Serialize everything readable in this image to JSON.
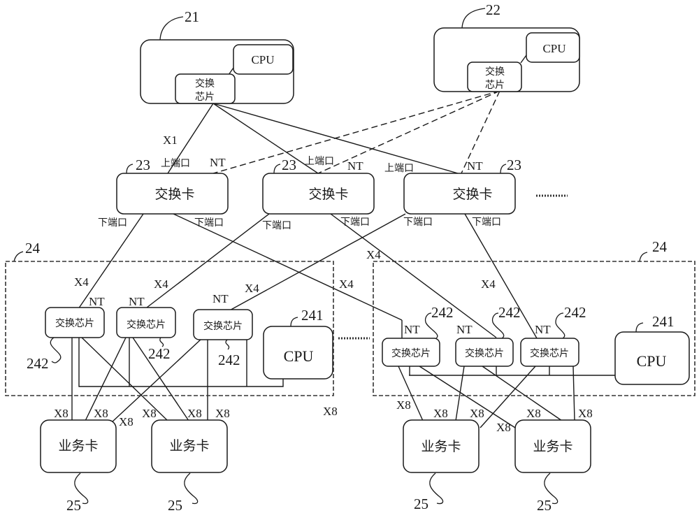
{
  "diagram": {
    "top_devices": [
      {
        "ref": "21",
        "cpu": "CPU",
        "chip_line1": "交换",
        "chip_line2": "芯片"
      },
      {
        "ref": "22",
        "cpu": "CPU",
        "chip_line1": "交换",
        "chip_line2": "芯片"
      }
    ],
    "link_x1": "X1",
    "switch_cards": [
      {
        "ref": "23",
        "label": "交换卡",
        "up_port": "上端口",
        "nt": "NT",
        "down_left": "下端口",
        "down_right": "下端口"
      },
      {
        "ref": "23",
        "label": "交换卡",
        "up_port": "上端口",
        "nt": "NT",
        "down_left": "下端口",
        "down_right": "下端口"
      },
      {
        "ref": "23",
        "label": "交换卡",
        "up_port": "上端口",
        "nt": "NT",
        "down_left": "下端口",
        "down_right": "下端口"
      }
    ],
    "ellipsis": "……",
    "line_cards": [
      {
        "ref": "24",
        "chips": [
          {
            "label": "交换芯片",
            "nt": "NT",
            "ref": "242",
            "link": "X4"
          },
          {
            "label": "交换芯片",
            "nt": "NT",
            "ref": "242",
            "link": "X4"
          },
          {
            "label": "交换芯片",
            "nt": "NT",
            "ref": "242",
            "link": "X4"
          }
        ],
        "cpu": {
          "label": "CPU",
          "ref": "241"
        }
      },
      {
        "ref": "24",
        "chips": [
          {
            "label": "交换芯片",
            "nt": "NT",
            "ref": "242",
            "link": "X4"
          },
          {
            "label": "交换芯片",
            "nt": "NT",
            "ref": "242",
            "link": "X4"
          },
          {
            "label": "交换芯片",
            "nt": "NT",
            "ref": "242",
            "link": "X4"
          }
        ],
        "cpu": {
          "label": "CPU",
          "ref": "241"
        }
      }
    ],
    "extra_x4": "X4",
    "service_cards": [
      {
        "label": "业务卡",
        "ref": "25"
      },
      {
        "label": "业务卡",
        "ref": "25"
      },
      {
        "label": "业务卡",
        "ref": "25"
      },
      {
        "label": "业务卡",
        "ref": "25"
      }
    ],
    "link_x8": "X8"
  }
}
